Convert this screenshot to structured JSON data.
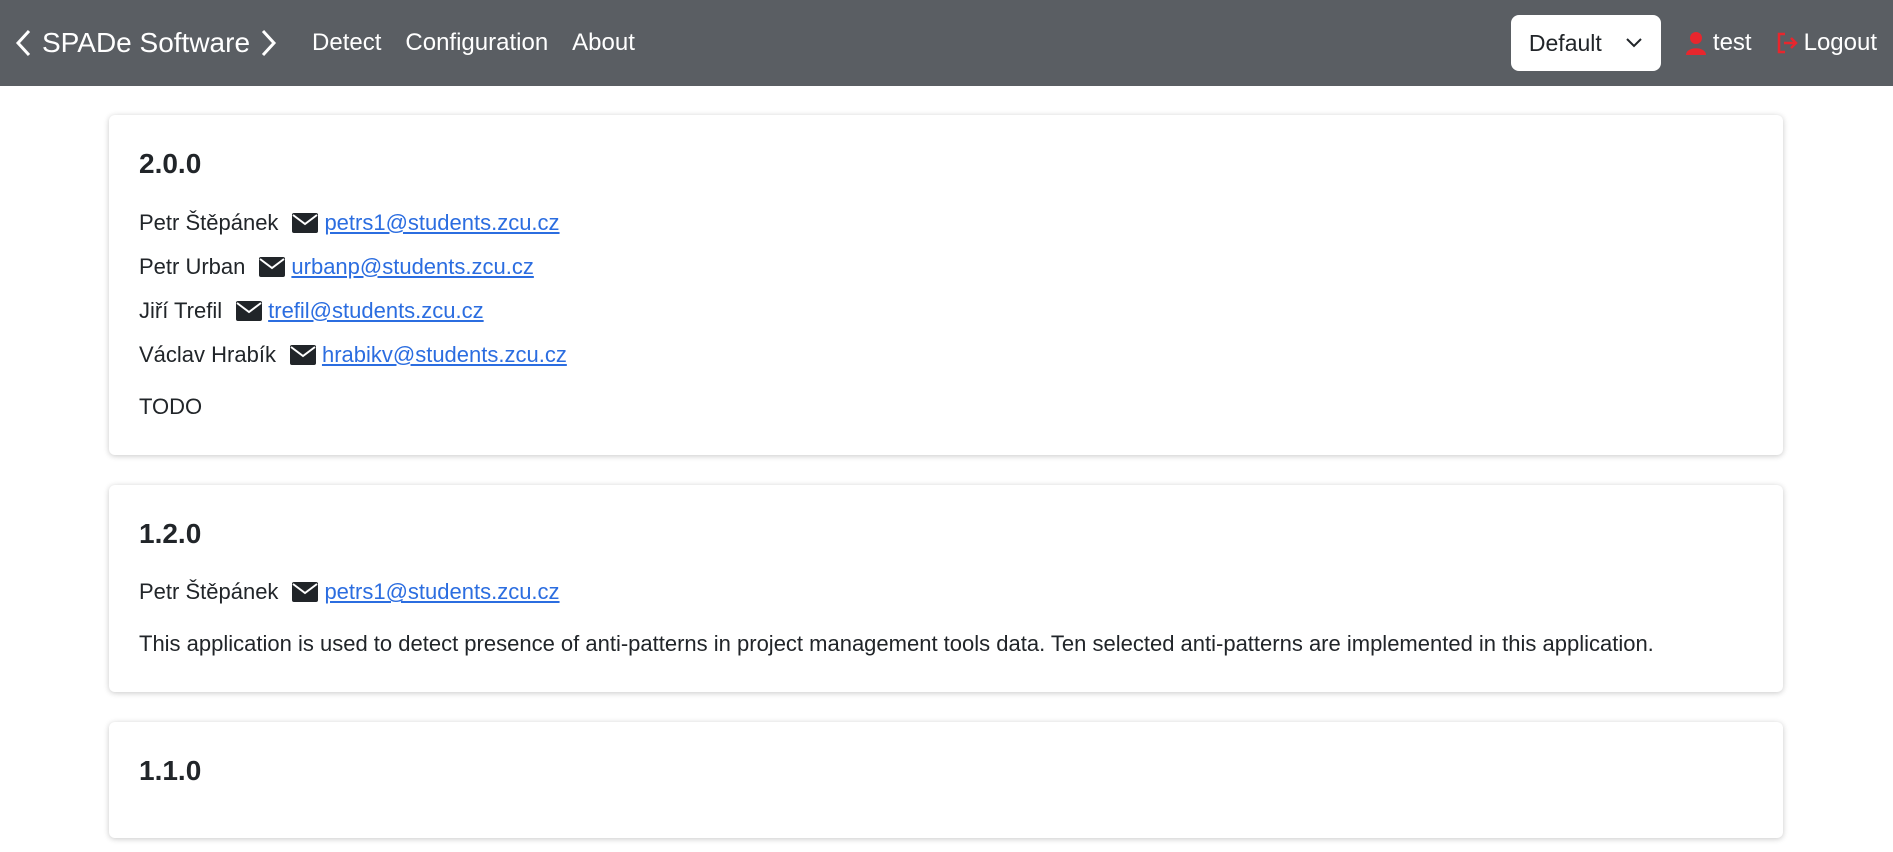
{
  "navbar": {
    "brand": "SPADe Software",
    "links": [
      "Detect",
      "Configuration",
      "About"
    ],
    "select_value": "Default",
    "user": "test",
    "logout": "Logout"
  },
  "releases": [
    {
      "version": "2.0.0",
      "authors": [
        {
          "name": "Petr Štěpánek",
          "email": "petrs1@students.zcu.cz"
        },
        {
          "name": "Petr Urban",
          "email": "urbanp@students.zcu.cz"
        },
        {
          "name": "Jiří Trefil",
          "email": "trefil@students.zcu.cz"
        },
        {
          "name": "Václav Hrabík",
          "email": "hrabikv@students.zcu.cz"
        }
      ],
      "description": "TODO"
    },
    {
      "version": "1.2.0",
      "authors": [
        {
          "name": "Petr Štěpánek",
          "email": "petrs1@students.zcu.cz"
        }
      ],
      "description": "This application is used to detect presence of anti-patterns in project management tools data. Ten selected anti-patterns are implemented in this application."
    },
    {
      "version": "1.1.0",
      "authors": [],
      "description": ""
    }
  ],
  "colors": {
    "navbar_bg": "#5a5e63",
    "link": "#2b6de0",
    "user_icon": "#e8262d"
  }
}
